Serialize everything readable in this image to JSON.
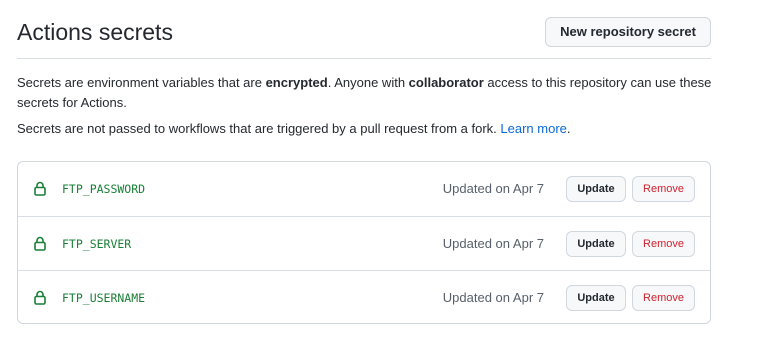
{
  "header": {
    "title": "Actions secrets",
    "new_button_label": "New repository secret"
  },
  "description": {
    "p1_a": "Secrets are environment variables that are ",
    "p1_b": "encrypted",
    "p1_c": ". Anyone with ",
    "p1_d": "collaborator",
    "p1_e": " access to this repository can use these secrets for Actions.",
    "p2_a": "Secrets are not passed to workflows that are triggered by a pull request from a fork. ",
    "p2_link": "Learn more",
    "p2_end": "."
  },
  "secrets": [
    {
      "name": "FTP_PASSWORD",
      "updated": "Updated on Apr 7",
      "update_label": "Update",
      "remove_label": "Remove"
    },
    {
      "name": "FTP_SERVER",
      "updated": "Updated on Apr 7",
      "update_label": "Update",
      "remove_label": "Remove"
    },
    {
      "name": "FTP_USERNAME",
      "updated": "Updated on Apr 7",
      "update_label": "Update",
      "remove_label": "Remove"
    }
  ],
  "colors": {
    "accent_link": "#0969da",
    "secret_name": "#1a7f37",
    "lock_icon": "#1a7f37",
    "remove_text": "#cf222e"
  },
  "icons": {
    "secret_icon": "lock-icon"
  }
}
